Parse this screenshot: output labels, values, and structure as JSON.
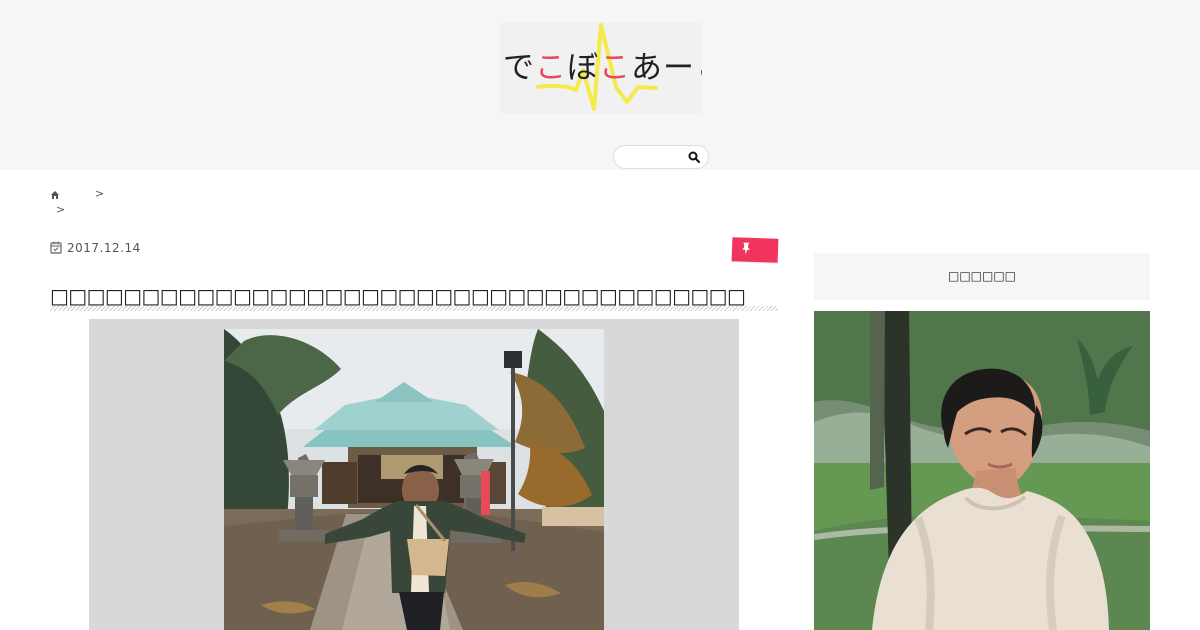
{
  "header": {
    "logo": {
      "prefix": "で",
      "pink_1": "こ",
      "middle": "ぼ",
      "pink_2": "こ",
      "suffix": "あーと"
    }
  },
  "article": {
    "date": "2017.12.14",
    "title": "□□□□□□□□□□□□□□□□□□□□□□□□□□□□□□□□□□□□□□"
  },
  "sidebar": {
    "heading": "□□□□□□"
  },
  "icons": {
    "home": "home-icon",
    "calendar": "calendar-icon",
    "category": "pin-icon",
    "search": "search-icon"
  },
  "colors": {
    "header_background": "#f7f6f6",
    "accent_pink": "#f0345e",
    "logo_pink": "#e44b61",
    "logo_yellow": "#f5e94b",
    "rule_gray": "#d0d0d0"
  }
}
